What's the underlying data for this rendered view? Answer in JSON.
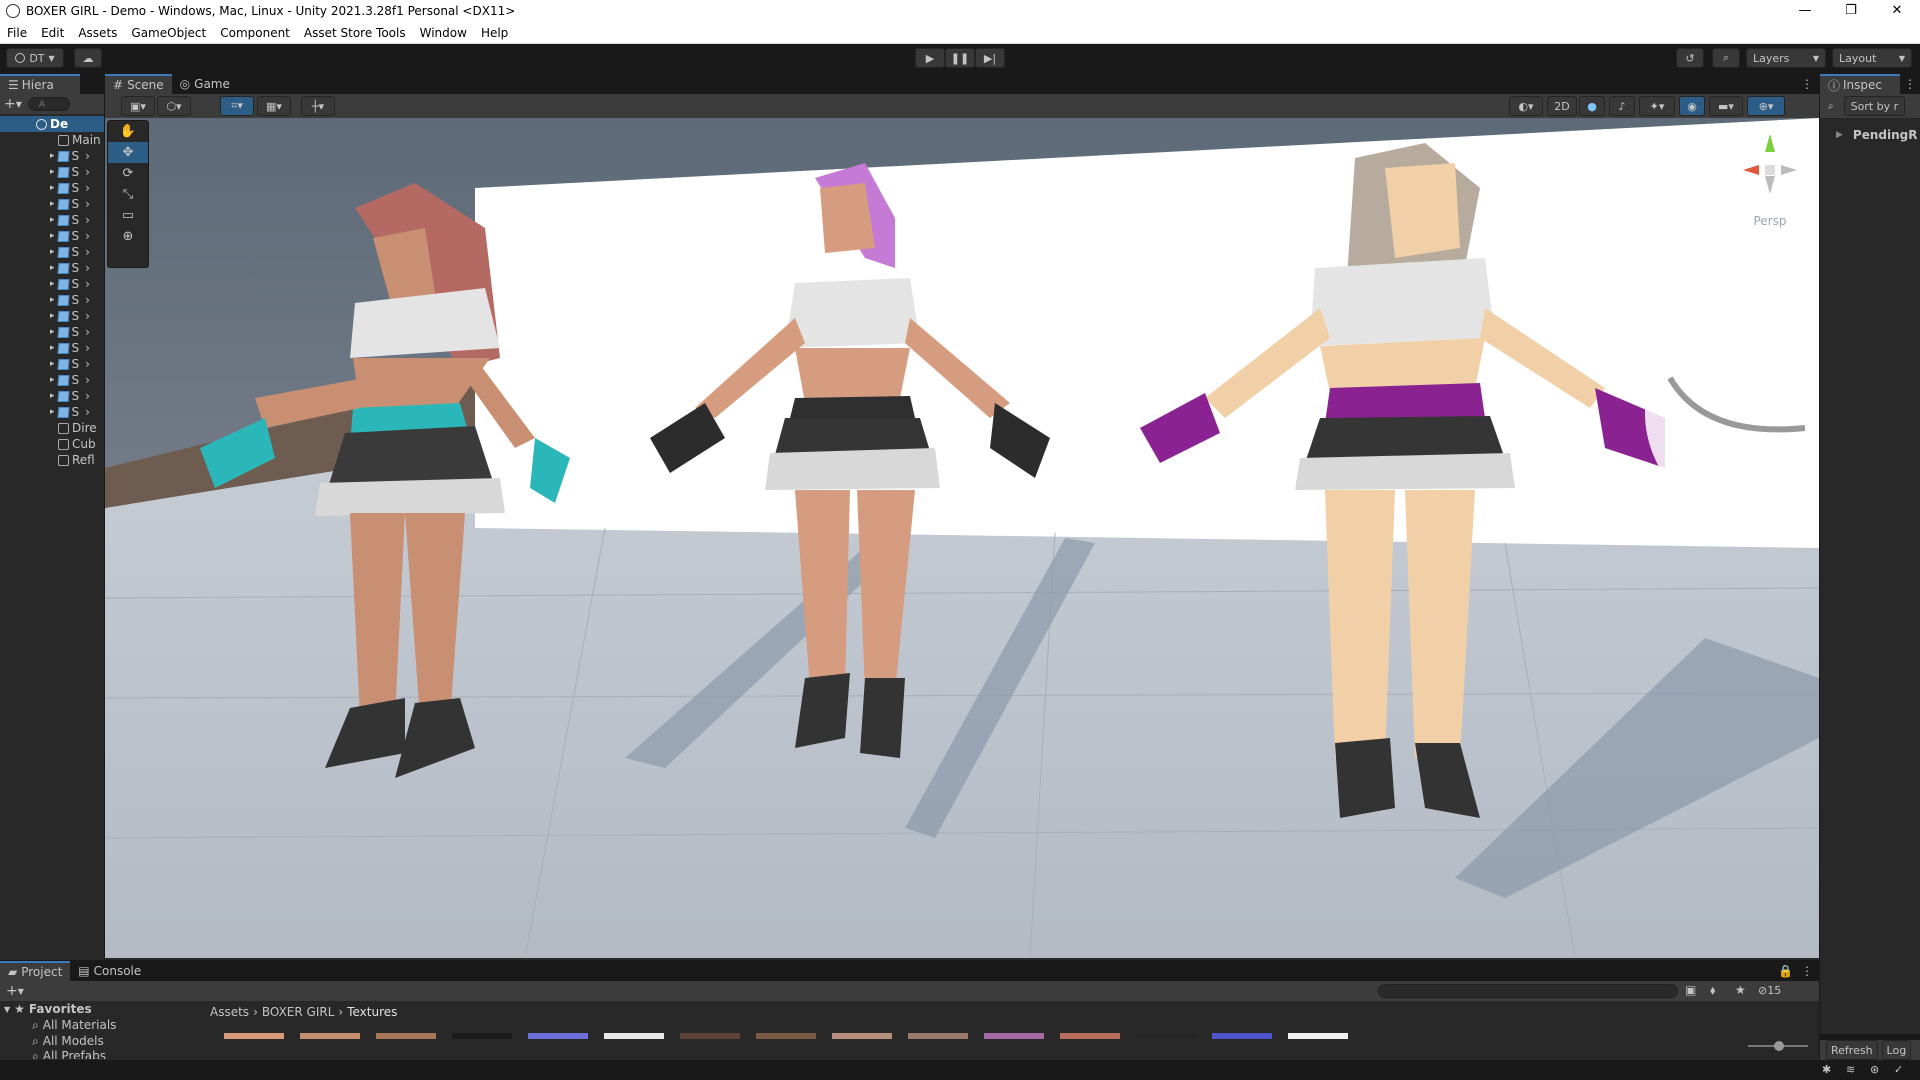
{
  "window": {
    "title": "BOXER GIRL - Demo - Windows, Mac, Linux - Unity 2021.3.28f1 Personal <DX11>",
    "controls": [
      "—",
      "❐",
      "✕"
    ]
  },
  "menu": [
    "File",
    "Edit",
    "Assets",
    "GameObject",
    "Component",
    "Asset Store Tools",
    "Window",
    "Help"
  ],
  "toolbar": {
    "account": "DT",
    "layers_label": "Layers",
    "layout_label": "Layout"
  },
  "hierarchy": {
    "tab_label": "Hiera",
    "search_placeholder": "A",
    "scene_name": "De",
    "items": [
      {
        "label": "Main",
        "icon": "gameobject-icon"
      },
      {
        "label": "S",
        "icon": "prefab-icon"
      },
      {
        "label": "S",
        "icon": "prefab-icon"
      },
      {
        "label": "S",
        "icon": "prefab-icon"
      },
      {
        "label": "S",
        "icon": "prefab-icon"
      },
      {
        "label": "S",
        "icon": "prefab-icon"
      },
      {
        "label": "S",
        "icon": "prefab-icon"
      },
      {
        "label": "S",
        "icon": "prefab-icon"
      },
      {
        "label": "S",
        "icon": "prefab-icon"
      },
      {
        "label": "S",
        "icon": "prefab-icon"
      },
      {
        "label": "S",
        "icon": "prefab-icon"
      },
      {
        "label": "S",
        "icon": "prefab-icon"
      },
      {
        "label": "S",
        "icon": "prefab-icon"
      },
      {
        "label": "S",
        "icon": "prefab-icon"
      },
      {
        "label": "S",
        "icon": "prefab-icon"
      },
      {
        "label": "S",
        "icon": "prefab-icon"
      },
      {
        "label": "S",
        "icon": "prefab-icon"
      },
      {
        "label": "S",
        "icon": "prefab-icon"
      },
      {
        "label": "Dire",
        "icon": "gameobject-icon"
      },
      {
        "label": "Cub",
        "icon": "gameobject-icon"
      },
      {
        "label": "Refl",
        "icon": "gameobject-icon"
      }
    ]
  },
  "scene": {
    "tabs": [
      "Scene",
      "Game"
    ],
    "mode_2d": "2D",
    "persp_label": "Persp"
  },
  "inspector": {
    "tab_label": "Inspec",
    "sort_label": "Sort by r",
    "pending_label": "PendingR",
    "refresh_label": "Refresh",
    "log_label": "Log"
  },
  "project": {
    "tabs": [
      "Project",
      "Console"
    ],
    "favorites_label": "Favorites",
    "favorites": [
      "All Materials",
      "All Models",
      "All Prefabs"
    ],
    "breadcrumb": [
      "Assets",
      "BOXER GIRL",
      "Textures"
    ],
    "hidden_count": "15",
    "thumbnail_colors": [
      "#d79a7b",
      "#c48f6f",
      "#a9765a",
      "#1b1b1b",
      "#6f6fd9",
      "#e8e8e8",
      "#5c4336",
      "#7b5a45",
      "#b58f7c",
      "#9c7b6c",
      "#a66aa6",
      "#b86e5c",
      "#252525",
      "#4f53c9",
      "#f0f0f0"
    ]
  }
}
